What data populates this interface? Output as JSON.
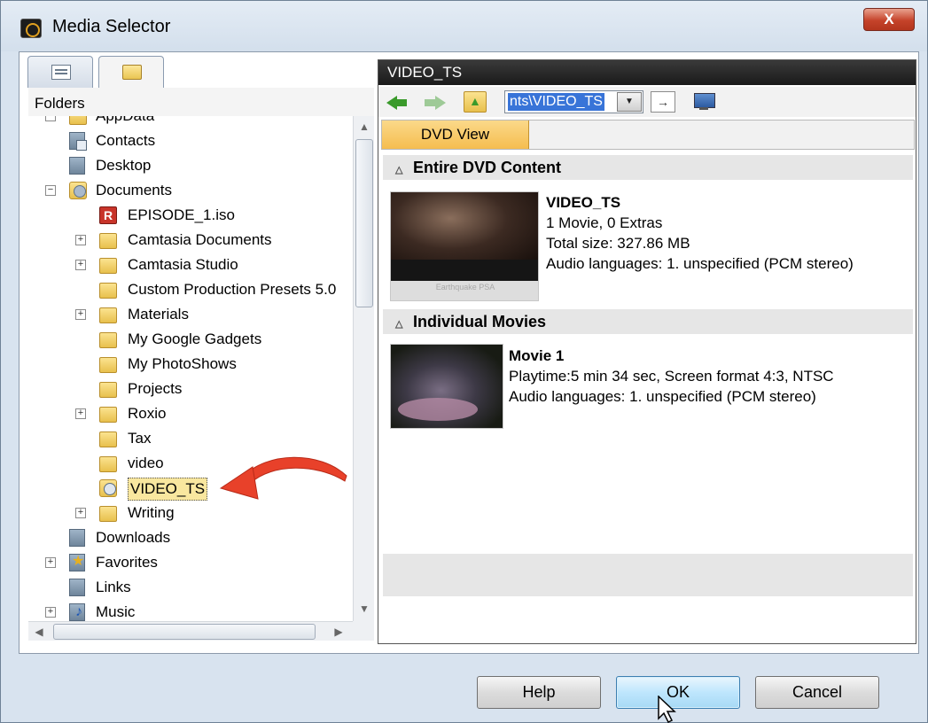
{
  "window": {
    "title": "Media Selector",
    "close_glyph": "X"
  },
  "left_panel": {
    "tabs": [
      {
        "name": "list-view-tab",
        "icon": "list-icon"
      },
      {
        "name": "folders-tab",
        "icon": "folder-icon",
        "active": true
      }
    ],
    "header": "Folders",
    "tree": [
      {
        "label": "AppData",
        "icon": "folder",
        "indent": 1,
        "expander": "-",
        "partial": true
      },
      {
        "label": "Contacts",
        "icon": "contacts",
        "indent": 1
      },
      {
        "label": "Desktop",
        "icon": "library",
        "indent": 1
      },
      {
        "label": "Documents",
        "icon": "documents",
        "indent": 1,
        "expander": "-"
      },
      {
        "label": "EPISODE_1.iso",
        "icon": "iso-file",
        "indent": 2
      },
      {
        "label": "Camtasia Documents",
        "icon": "folder",
        "indent": 2,
        "expander": "+"
      },
      {
        "label": "Camtasia Studio",
        "icon": "folder",
        "indent": 2,
        "expander": "+"
      },
      {
        "label": "Custom Production Presets 5.0",
        "icon": "folder",
        "indent": 2
      },
      {
        "label": "Materials",
        "icon": "folder",
        "indent": 2,
        "expander": "+"
      },
      {
        "label": "My Google Gadgets",
        "icon": "folder",
        "indent": 2
      },
      {
        "label": "My PhotoShows",
        "icon": "folder",
        "indent": 2
      },
      {
        "label": "Projects",
        "icon": "folder",
        "indent": 2
      },
      {
        "label": "Roxio",
        "icon": "folder",
        "indent": 2,
        "expander": "+"
      },
      {
        "label": "Tax",
        "icon": "folder",
        "indent": 2
      },
      {
        "label": "video",
        "icon": "folder",
        "indent": 2
      },
      {
        "label": "VIDEO_TS",
        "icon": "dvd-folder",
        "indent": 2,
        "selected": true
      },
      {
        "label": "Writing",
        "icon": "folder",
        "indent": 2,
        "expander": "+"
      },
      {
        "label": "Downloads",
        "icon": "library",
        "indent": 1
      },
      {
        "label": "Favorites",
        "icon": "favorites",
        "indent": 1,
        "expander": "+"
      },
      {
        "label": "Links",
        "icon": "library",
        "indent": 1
      },
      {
        "label": "Music",
        "icon": "music",
        "indent": 1,
        "expander": "+"
      }
    ],
    "annotation": "red-curved-arrow pointing to VIDEO_TS"
  },
  "right_panel": {
    "title": "VIDEO_TS",
    "path": "nts\\VIDEO_TS",
    "view_tab": "DVD View",
    "sections": {
      "entire": {
        "heading": "Entire DVD Content",
        "item_title": "VIDEO_TS",
        "line1": "1 Movie, 0 Extras",
        "line2": "Total size: 327.86 MB",
        "line3": "Audio languages: 1. unspecified (PCM stereo)",
        "thumb_caption": "Earthquake PSA"
      },
      "individual": {
        "heading": "Individual Movies",
        "item_title": "Movie 1",
        "line1": "Playtime:5 min 34 sec, Screen format 4:3, NTSC",
        "line2": "Audio languages: 1. unspecified (PCM stereo)"
      }
    }
  },
  "buttons": {
    "help": "Help",
    "ok": "OK",
    "cancel": "Cancel"
  },
  "colors": {
    "selection": "#f9e79f",
    "view_tab": "#f5bd4f",
    "ok_button": "#bee6fd",
    "annotation_arrow": "#e8412a"
  }
}
